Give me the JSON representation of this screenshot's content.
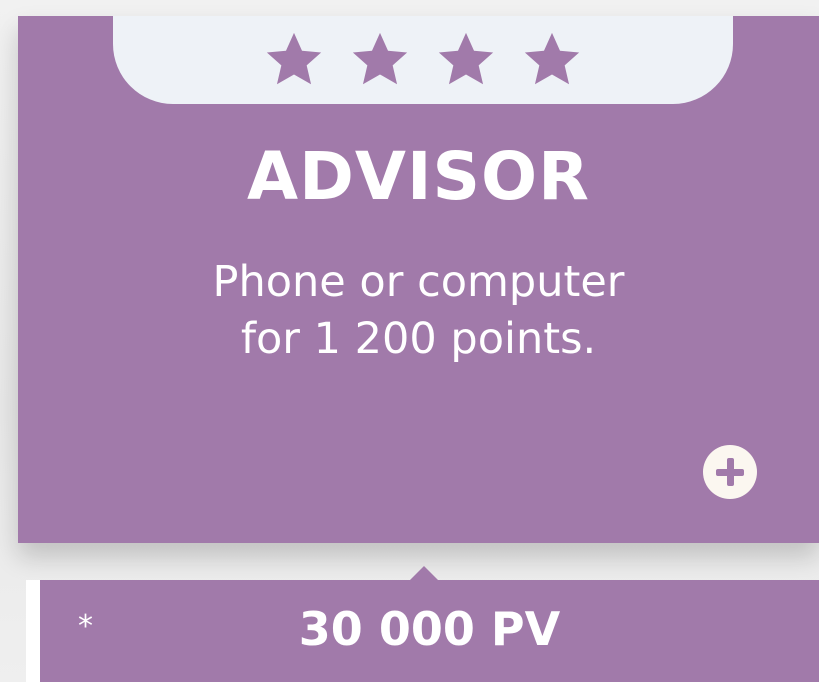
{
  "card": {
    "star_rating": 4,
    "stars": [
      "star-icon",
      "star-icon",
      "star-icon",
      "star-icon"
    ],
    "title": "ADVISOR",
    "description_line1": "Phone or computer",
    "description_line2": "for 1 200 points.",
    "add_icon": "plus-circle-icon"
  },
  "pv": {
    "asterisk": "*",
    "value": "30 000 PV"
  },
  "colors": {
    "card_bg": "#a17aaa",
    "star": "#a17aaa",
    "cap_bg": "#eef2f7",
    "text": "#ffffff",
    "page_bg": "#ececec"
  }
}
